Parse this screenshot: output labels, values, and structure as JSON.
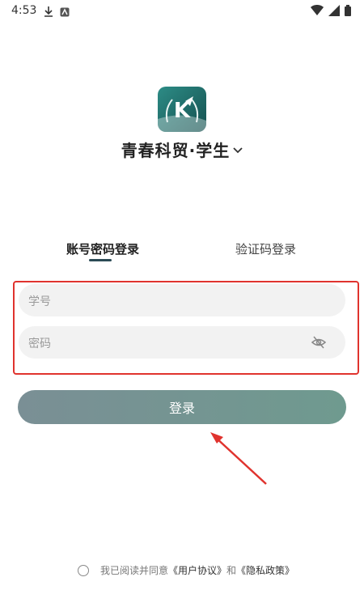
{
  "status_bar": {
    "time": "4:53",
    "left_icons": [
      "download-icon",
      "notification-icon"
    ],
    "right_icons": [
      "wifi-icon",
      "signal-icon",
      "battery-icon"
    ]
  },
  "app": {
    "logo_text": "K",
    "title": "青春科贸·学生"
  },
  "tabs": [
    {
      "label": "账号密码登录",
      "active": true
    },
    {
      "label": "验证码登录",
      "active": false
    }
  ],
  "form": {
    "student_id_placeholder": "学号",
    "password_placeholder": "密码",
    "login_label": "登录"
  },
  "agreement": {
    "prefix": "我已阅读并同意",
    "user_agreement": "《用户协议》",
    "and": "和",
    "privacy_policy": "《隐私政策》"
  },
  "colors": {
    "accent_dark": "#2b4a55",
    "button_gradient_start": "#7a8f95",
    "button_gradient_end": "#6f9a8f",
    "highlight": "#e0332e",
    "logo_bg": "#1e6f6c"
  }
}
